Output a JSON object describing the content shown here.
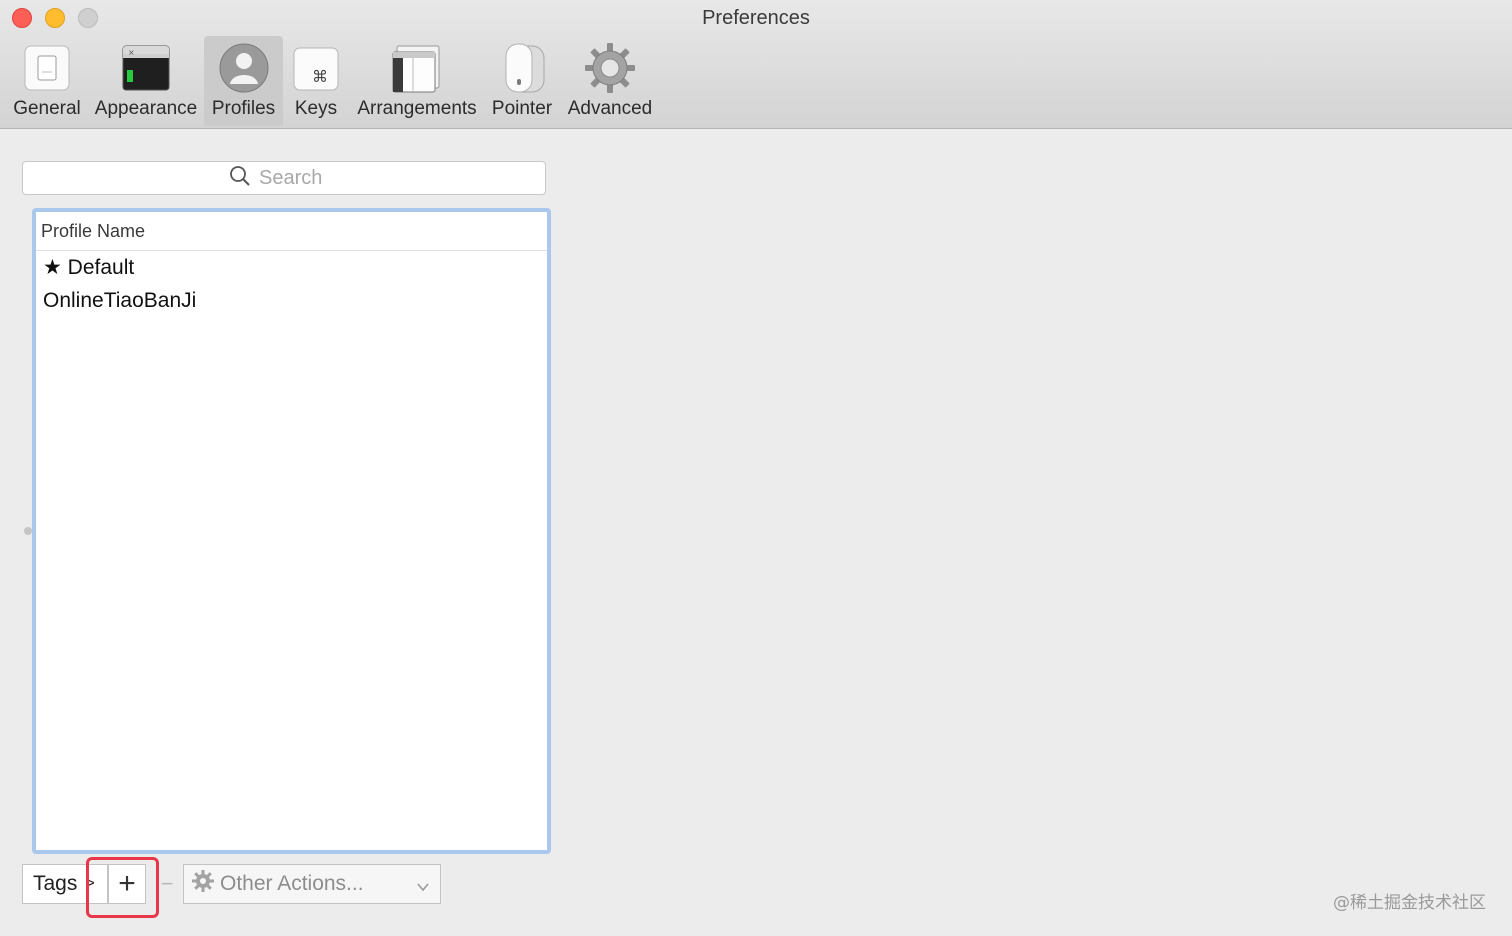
{
  "window": {
    "title": "Preferences"
  },
  "toolbar": {
    "items": [
      {
        "label": "General",
        "icon": "general-icon",
        "selected": false
      },
      {
        "label": "Appearance",
        "icon": "appearance-icon",
        "selected": false
      },
      {
        "label": "Profiles",
        "icon": "profiles-icon",
        "selected": true
      },
      {
        "label": "Keys",
        "icon": "keys-icon",
        "selected": false
      },
      {
        "label": "Arrangements",
        "icon": "arrangements-icon",
        "selected": false
      },
      {
        "label": "Pointer",
        "icon": "pointer-icon",
        "selected": false
      },
      {
        "label": "Advanced",
        "icon": "advanced-icon",
        "selected": false
      }
    ]
  },
  "search": {
    "placeholder": "Search",
    "value": ""
  },
  "profiles_table": {
    "header": "Profile Name",
    "rows": [
      {
        "name": "★ Default",
        "is_default": true
      },
      {
        "name": "OnlineTiaoBanJi",
        "is_default": false
      }
    ]
  },
  "bottom_bar": {
    "tags_label": "Tags",
    "tags_chevron": ">",
    "add_label": "+",
    "remove_label": "−",
    "other_actions_label": "Other Actions..."
  },
  "watermark": "@稀土掘金技术社区",
  "colors": {
    "highlight": "#e8374a",
    "table_focus_ring": "#a9c8ec"
  }
}
